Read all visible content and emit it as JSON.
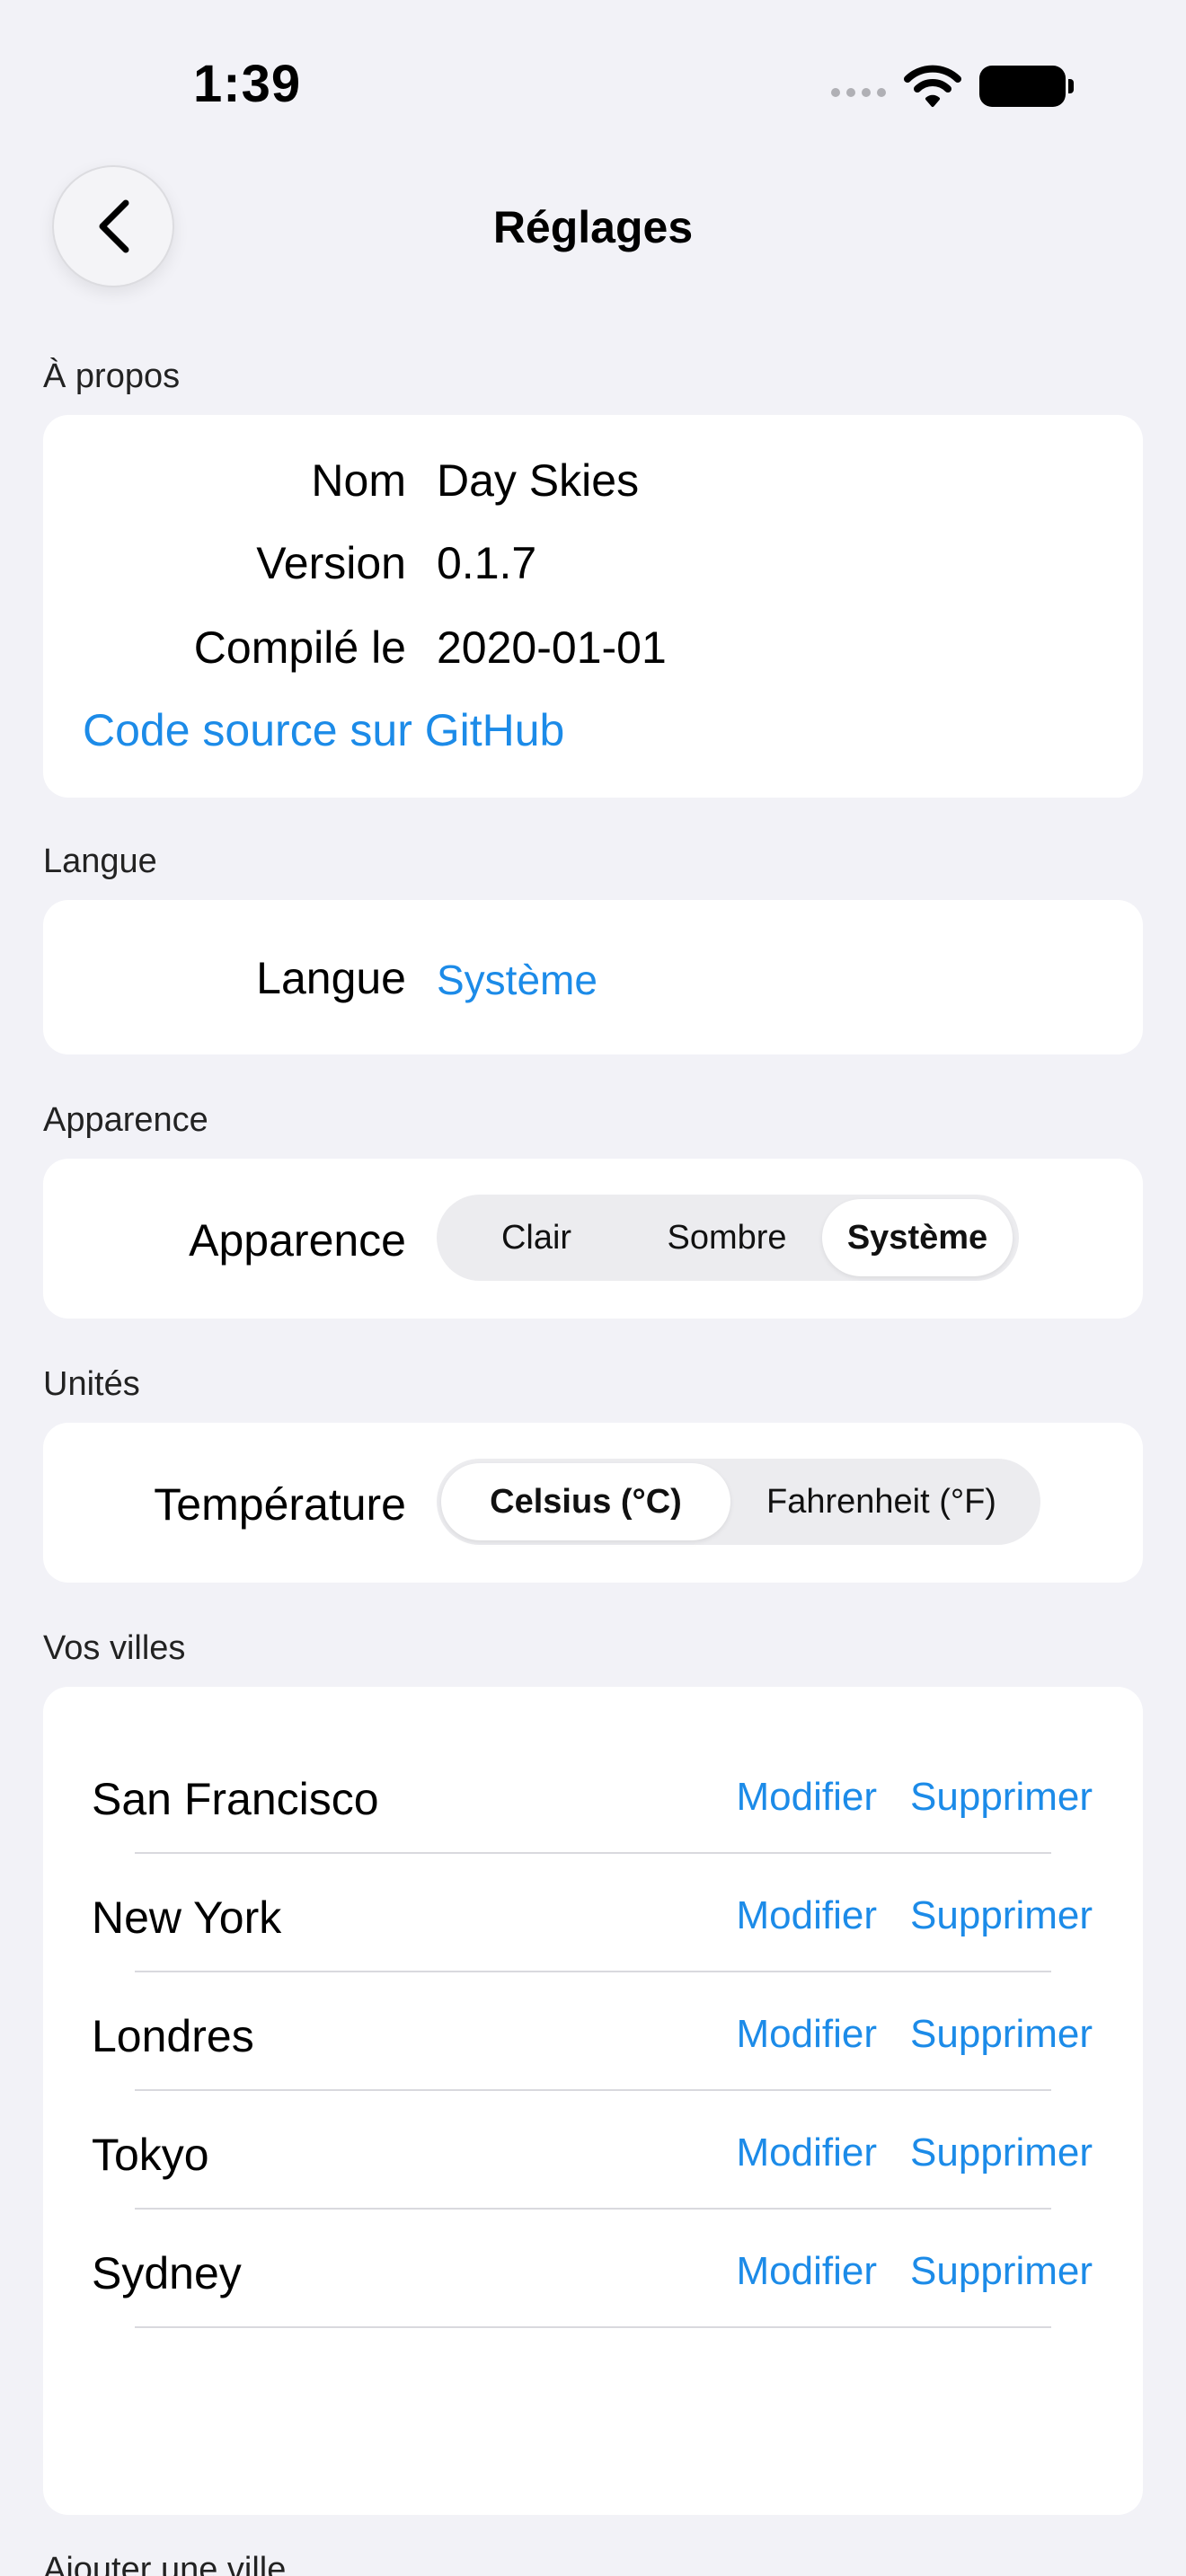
{
  "status_bar": {
    "time": "1:39"
  },
  "nav": {
    "title": "Réglages"
  },
  "about": {
    "header": "À propos",
    "rows": [
      {
        "label": "Nom",
        "value": "Day Skies"
      },
      {
        "label": "Version",
        "value": "0.1.7"
      },
      {
        "label": "Compilé le",
        "value": "2020-01-01"
      }
    ],
    "link": "Code source sur GitHub"
  },
  "language": {
    "header": "Langue",
    "label": "Langue",
    "value": "Système"
  },
  "appearance": {
    "header": "Apparence",
    "label": "Apparence",
    "options": [
      "Clair",
      "Sombre",
      "Système"
    ],
    "selected": "Système"
  },
  "units": {
    "header": "Unités",
    "label": "Température",
    "options": [
      "Celsius (°C)",
      "Fahrenheit (°F)"
    ],
    "selected": "Celsius (°C)"
  },
  "cities": {
    "header": "Vos villes",
    "edit_label": "Modifier",
    "delete_label": "Supprimer",
    "items": [
      "San Francisco",
      "New York",
      "Londres",
      "Tokyo",
      "Sydney"
    ]
  },
  "add_city": {
    "header": "Ajouter une ville"
  },
  "colors": {
    "accent": "#1C8BE8",
    "background": "#F2F2F7",
    "card": "#FFFFFF"
  }
}
